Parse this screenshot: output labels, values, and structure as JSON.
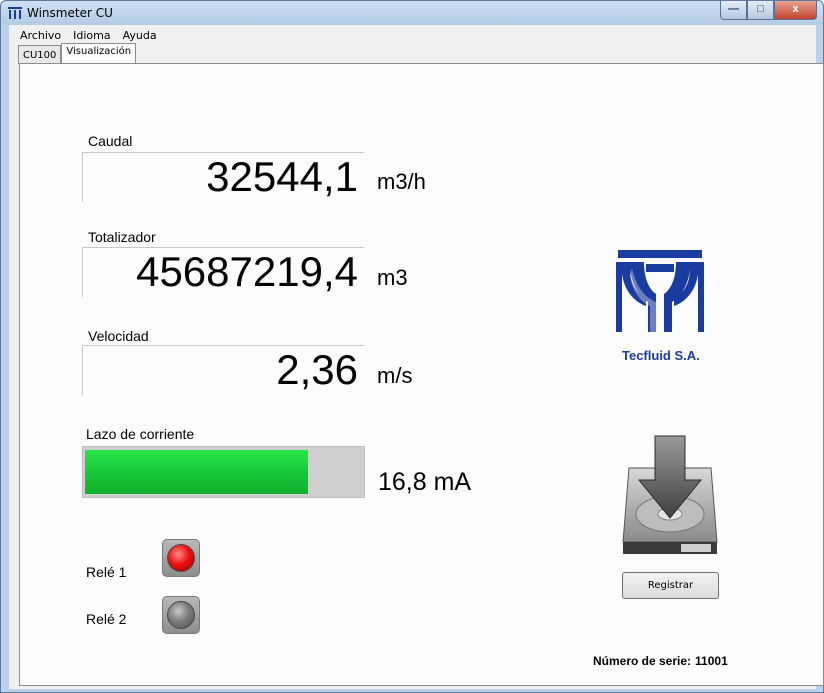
{
  "window": {
    "title": "Winsmeter CU",
    "minimize_glyph": "—",
    "maximize_glyph": "□",
    "close_glyph": "x"
  },
  "menu": [
    "Archivo",
    "Idioma",
    "Ayuda"
  ],
  "tabs": [
    {
      "label": "CU100",
      "active": false
    },
    {
      "label": "Visualización",
      "active": true
    }
  ],
  "readings": {
    "caudal": {
      "label": "Caudal",
      "value": "32544,1",
      "unit": "m3/h"
    },
    "totalizador": {
      "label": "Totalizador",
      "value": "45687219,4",
      "unit": "m3"
    },
    "velocidad": {
      "label": "Velocidad",
      "value": "2,36",
      "unit": "m/s"
    }
  },
  "current_loop": {
    "label": "Lazo de corriente",
    "value_text": "16,8 mA",
    "fill_fraction": 0.805,
    "fill_color": "#1fd33f"
  },
  "relays": [
    {
      "label": "Relé 1",
      "state": "on",
      "color": "#ee1111"
    },
    {
      "label": "Relé 2",
      "state": "off",
      "color": "#7d7d7d"
    }
  ],
  "brand": {
    "company": "Tecfluid S.A.",
    "logo_icon": "tecfluid-logo",
    "color": "#1a3ca0"
  },
  "register": {
    "icon": "save-to-disk-icon",
    "button_label": "Registrar"
  },
  "serial": {
    "label": "Número de serie:",
    "value": "11001"
  }
}
